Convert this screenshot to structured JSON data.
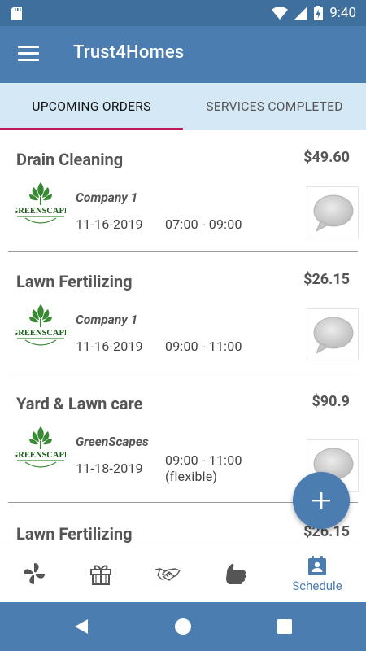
{
  "status_bar": {
    "time": "9:40",
    "icons": [
      "sd-card-icon",
      "wifi-icon",
      "signal-icon",
      "battery-charging-icon"
    ]
  },
  "app_bar": {
    "menu_icon": "hamburger-menu-icon",
    "title": "Trust4Homes"
  },
  "tabs": [
    {
      "label": "UPCOMING ORDERS",
      "selected": true
    },
    {
      "label": "SERVICES COMPLETED",
      "selected": false
    }
  ],
  "colors": {
    "primary": "#4b7db1",
    "status_bar": "#3f6f9c",
    "tab_background": "#d4e8f5",
    "tab_indicator": "#c2185b",
    "logo_green": "#3a8a35"
  },
  "orders": [
    {
      "service": "Drain Cleaning",
      "price": "$49.60",
      "company": "Company 1",
      "date": "11-16-2019",
      "time": "07:00 - 09:00",
      "time_note": "",
      "logo": "greenscape-logo",
      "chat_icon": "chat-bubble-icon"
    },
    {
      "service": "Lawn Fertilizing",
      "price": "$26.15",
      "company": "Company 1",
      "date": "11-16-2019",
      "time": "09:00 - 11:00",
      "time_note": "",
      "logo": "greenscape-logo",
      "chat_icon": "chat-bubble-icon"
    },
    {
      "service": "Yard & Lawn care",
      "price": "$90.9",
      "company": "GreenScapes",
      "date": "11-18-2019",
      "time": "09:00 - 11:00",
      "time_note": "(flexible)",
      "logo": "greenscape-logo",
      "chat_icon": "chat-bubble-icon"
    },
    {
      "service": "Lawn Fertilizing",
      "price": "$26.15",
      "company": "",
      "date": "",
      "time": "",
      "time_note": "",
      "logo": "",
      "chat_icon": ""
    }
  ],
  "fab": {
    "icon": "plus-icon"
  },
  "logo_text": "GREENSCAPE",
  "bottom_nav": [
    {
      "icon": "pinwheel-icon",
      "label": "",
      "selected": false
    },
    {
      "icon": "gift-icon",
      "label": "",
      "selected": false
    },
    {
      "icon": "handshake-icon",
      "label": "",
      "selected": false
    },
    {
      "icon": "thumbs-up-icon",
      "label": "",
      "selected": false
    },
    {
      "icon": "calendar-person-icon",
      "label": "Schedule",
      "selected": true
    }
  ],
  "system_nav": [
    "back-icon",
    "home-icon",
    "recents-icon"
  ]
}
